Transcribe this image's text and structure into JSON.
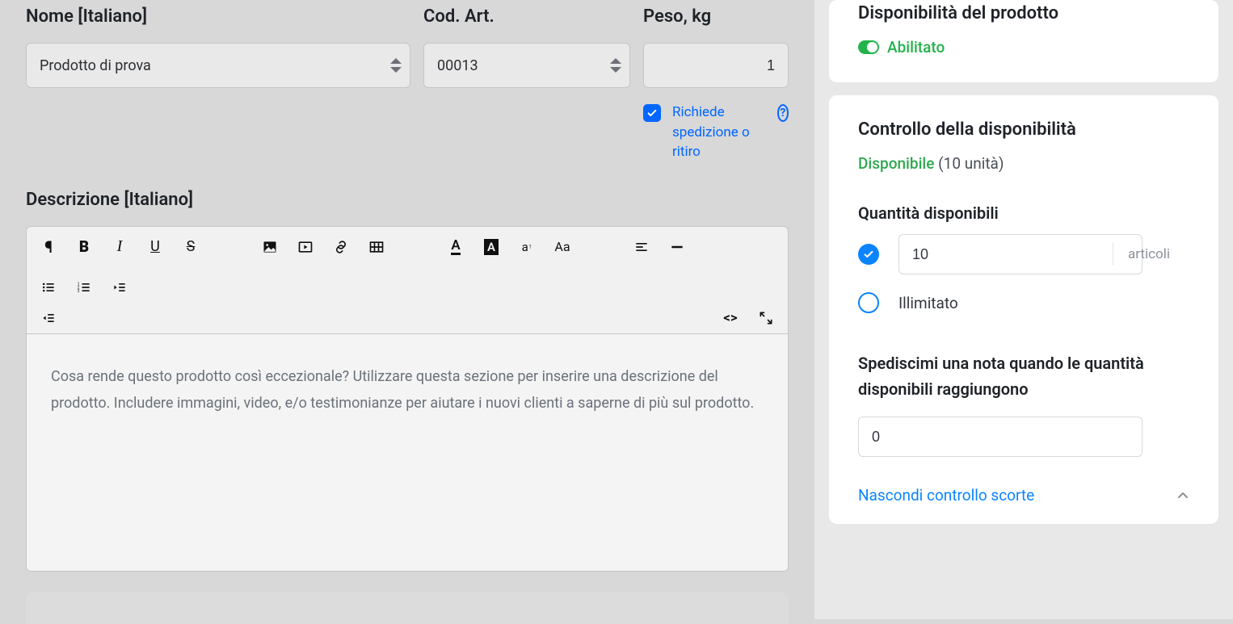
{
  "main": {
    "nome": {
      "label": "Nome [Italiano]",
      "value": "Prodotto di prova"
    },
    "cod": {
      "label": "Cod. Art.",
      "value": "00013"
    },
    "peso": {
      "label": "Peso, kg",
      "value": "1"
    },
    "shipping": {
      "checked": true,
      "text": "Richiede spedizione o ritiro"
    },
    "desc": {
      "label": "Descrizione [Italiano]",
      "placeholder": "Cosa rende questo prodotto così eccezionale? Utilizzare questa sezione per inserire una descrizione del prodotto. Includere immagini, video, e/o testimonianze per aiutare i nuovi clienti a saperne di più sul prodotto."
    }
  },
  "sidebar": {
    "availability": {
      "title": "Disponibilità del prodotto",
      "enabled_label": "Abilitato"
    },
    "stock": {
      "title": "Controllo della disponibilità",
      "status_green": "Disponibile",
      "status_grey": "(10 unità)",
      "qty_title": "Quantità disponibili",
      "qty_value": "10",
      "qty_unit": "articoli",
      "unlimited_label": "Illimitato",
      "notify_title": "Spediscimi una nota quando le quantità disponibili raggiungono",
      "notify_value": "0",
      "hide_link": "Nascondi controllo scorte"
    }
  }
}
